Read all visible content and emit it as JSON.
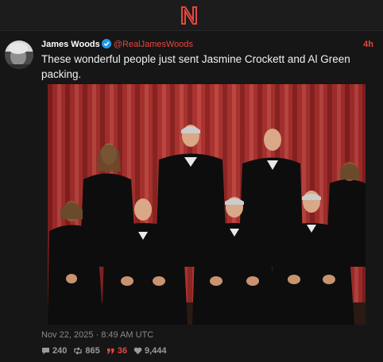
{
  "app": {
    "logo_letter": "N",
    "accent_color": "#e8463f"
  },
  "tweet": {
    "author_name": "James Woods",
    "handle": "@RealJamesWoods",
    "time_ago": "4h",
    "text": "These wonderful people just sent Jasmine Crockett and Al Green packing.",
    "timestamp": "Nov 22, 2025 · 8:49 AM UTC",
    "stats": {
      "replies": "240",
      "retweets": "865",
      "quotes": "36",
      "likes": "9,444"
    },
    "icons": {
      "verified": "verified-badge-icon",
      "replies": "comment-icon",
      "retweets": "retweet-icon",
      "quotes": "quote-icon",
      "likes": "heart-icon"
    }
  }
}
